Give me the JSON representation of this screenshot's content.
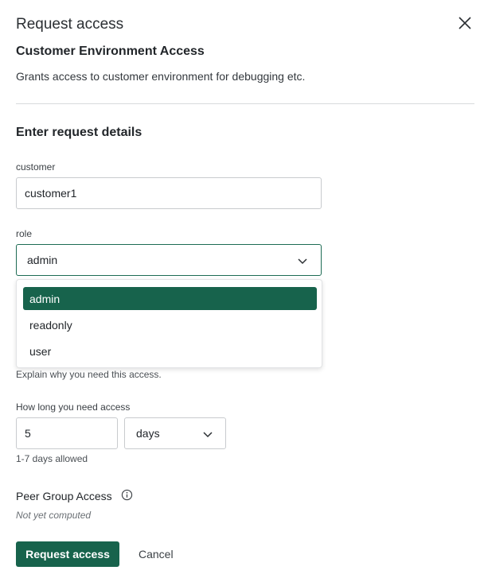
{
  "header": {
    "title": "Request access",
    "close_icon": "close-icon"
  },
  "access": {
    "name": "Customer Environment Access",
    "description": "Grants access to customer environment for debugging etc."
  },
  "form": {
    "section_title": "Enter request details",
    "customer": {
      "label": "customer",
      "value": "customer1"
    },
    "role": {
      "label": "role",
      "value": "admin",
      "icon": "chevron-down-icon",
      "options": [
        "admin",
        "readonly",
        "user"
      ],
      "selected_index": 0
    },
    "reason_hint": "Explain why you need this access.",
    "duration": {
      "label": "How long you need access",
      "value": "5",
      "unit": "days",
      "unit_icon": "chevron-down-icon",
      "hint": "1-7 days allowed"
    },
    "peer_group": {
      "label": "Peer Group Access",
      "icon": "info-icon",
      "status": "Not yet computed"
    }
  },
  "actions": {
    "submit": "Request access",
    "cancel": "Cancel"
  },
  "colors": {
    "primary": "#17634c",
    "focus_border": "#1d6b54"
  }
}
